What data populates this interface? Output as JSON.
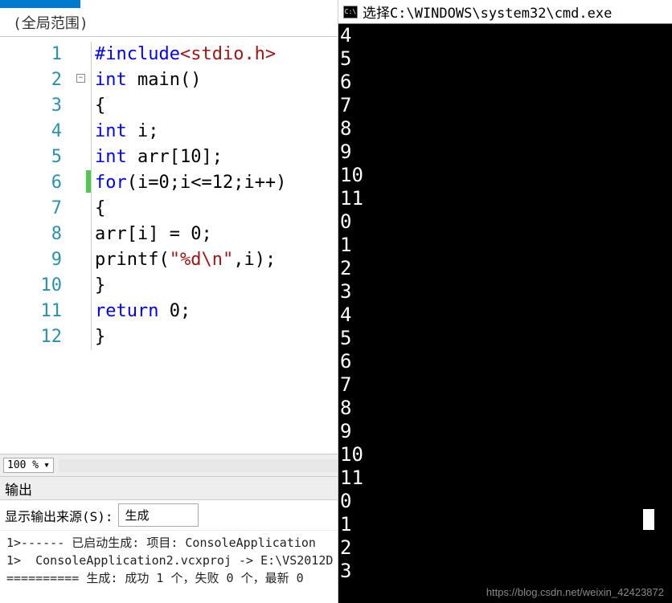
{
  "scope_label": "(全局范围)",
  "code": {
    "lines": [
      {
        "n": "1",
        "tokens": [
          {
            "t": "#include",
            "c": "kw-inc"
          },
          {
            "t": "<stdio.h>",
            "c": "kw-hdr"
          }
        ]
      },
      {
        "n": "2",
        "tokens": [
          {
            "t": "int",
            "c": "kw-blue"
          },
          {
            "t": " main()",
            "c": "plain"
          }
        ]
      },
      {
        "n": "3",
        "tokens": [
          {
            "t": "{",
            "c": "plain"
          }
        ]
      },
      {
        "n": "4",
        "tokens": [
          {
            "t": "int",
            "c": "kw-blue"
          },
          {
            "t": " i;",
            "c": "plain"
          }
        ]
      },
      {
        "n": "5",
        "tokens": [
          {
            "t": "int",
            "c": "kw-blue"
          },
          {
            "t": " arr[10];",
            "c": "plain"
          }
        ]
      },
      {
        "n": "6",
        "tokens": [
          {
            "t": "for",
            "c": "kw-blue"
          },
          {
            "t": "(i=0;i<=12;i++)",
            "c": "plain"
          }
        ]
      },
      {
        "n": "7",
        "tokens": [
          {
            "t": "{",
            "c": "plain"
          }
        ]
      },
      {
        "n": "8",
        "tokens": [
          {
            "t": "arr[i] = 0;",
            "c": "plain"
          }
        ]
      },
      {
        "n": "9",
        "tokens": [
          {
            "t": "printf(",
            "c": "plain"
          },
          {
            "t": "\"%d\\n\"",
            "c": "kw-str"
          },
          {
            "t": ",i);",
            "c": "plain"
          }
        ]
      },
      {
        "n": "10",
        "tokens": [
          {
            "t": "}",
            "c": "plain"
          }
        ]
      },
      {
        "n": "11",
        "tokens": [
          {
            "t": "return",
            "c": "kw-blue"
          },
          {
            "t": " 0;",
            "c": "plain"
          }
        ]
      },
      {
        "n": "12",
        "tokens": [
          {
            "t": "}",
            "c": "plain"
          }
        ]
      }
    ]
  },
  "zoom_level": "100 %",
  "output_panel_title": "输出",
  "output_source_label": "显示输出来源(S):",
  "output_source_value": "生成",
  "output_lines": [
    "1>------ 已启动生成: 项目: ConsoleApplication",
    "1>  ConsoleApplication2.vcxproj -> E:\\VS2012D",
    "========== 生成: 成功 1 个，失败 0 个，最新 0"
  ],
  "cmd_title": "选择C:\\WINDOWS\\system32\\cmd.exe",
  "cmd_output": [
    "4",
    "5",
    "6",
    "7",
    "8",
    "9",
    "10",
    "11",
    "0",
    "1",
    "2",
    "3",
    "4",
    "5",
    "6",
    "7",
    "8",
    "9",
    "10",
    "11",
    "0",
    "1",
    "2",
    "3"
  ],
  "watermark": "https://blog.csdn.net/weixin_42423872"
}
